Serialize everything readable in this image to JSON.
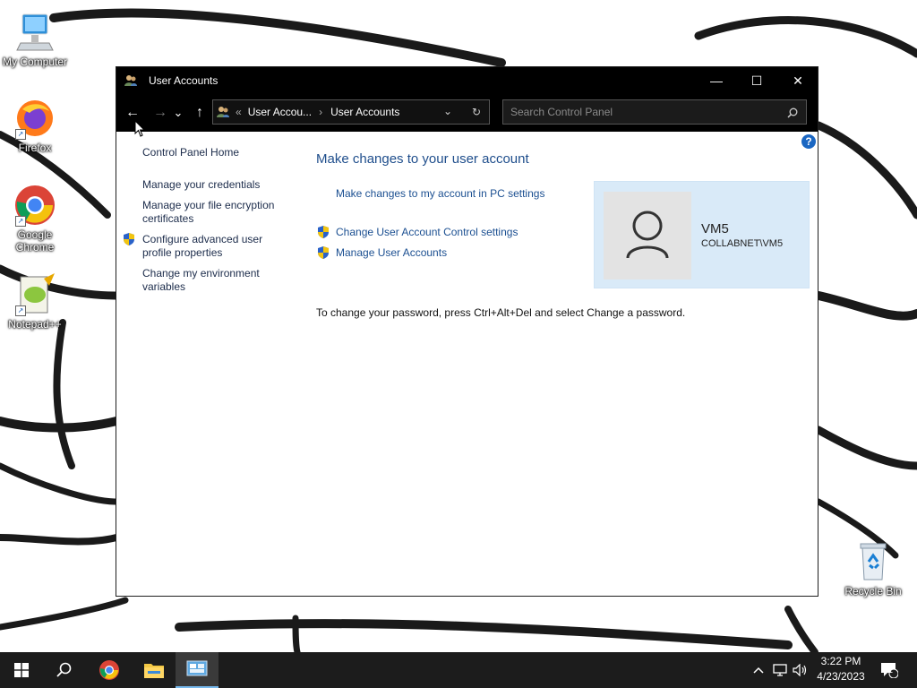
{
  "desktop": {
    "icons": [
      {
        "label": "My Computer",
        "icon": "computer-icon"
      },
      {
        "label": "Firefox",
        "icon": "firefox-icon"
      },
      {
        "label": "Google Chrome",
        "icon": "chrome-icon"
      },
      {
        "label": "Notepad++",
        "icon": "notepad-plus-plus-icon"
      },
      {
        "label": "Recycle Bin",
        "icon": "recycle-bin-icon"
      }
    ]
  },
  "window": {
    "title": "User Accounts",
    "controls": {
      "minimize": "—",
      "maximize": "☐",
      "close": "✕"
    },
    "nav": {
      "back": "←",
      "forward": "→",
      "recent": "⌄",
      "up": "↑",
      "breadcrumb": [
        "User Accou...",
        "User Accounts"
      ],
      "breadcrumb_prefix": "«",
      "breadcrumb_sep": "›",
      "refresh": "↻",
      "search_placeholder": "Search Control Panel"
    },
    "help": "?",
    "left_pane": {
      "home": "Control Panel Home",
      "items": [
        "Manage your credentials",
        "Manage your file encryption certificates",
        "Configure advanced user profile properties",
        "Change my environment variables"
      ]
    },
    "main": {
      "heading": "Make changes to your user account",
      "links": [
        "Make changes to my account in PC settings",
        "Change User Account Control settings",
        "Manage User Accounts"
      ],
      "note": "To change your password, press Ctrl+Alt+Del and select Change a password."
    },
    "user": {
      "name": "VM5",
      "domain": "COLLABNET\\VM5"
    }
  },
  "taskbar": {
    "clock_time": "3:22 PM",
    "clock_date": "4/23/2023",
    "notification_count": "1",
    "accent": "#1c1c1c"
  }
}
